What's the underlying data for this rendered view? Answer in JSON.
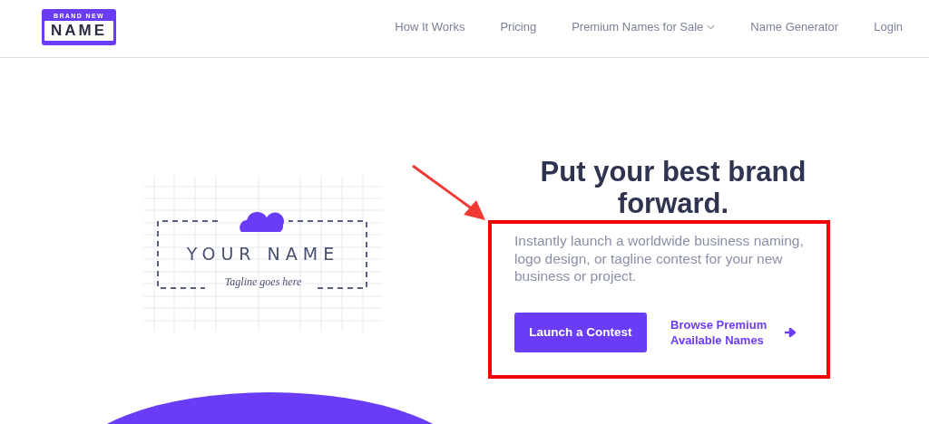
{
  "logo": {
    "top": "BRAND NEW",
    "main": "NAME"
  },
  "nav": [
    {
      "label": "How It Works",
      "dropdown": false
    },
    {
      "label": "Pricing",
      "dropdown": false
    },
    {
      "label": "Premium Names for Sale",
      "dropdown": true
    },
    {
      "label": "Name Generator",
      "dropdown": false
    },
    {
      "label": "Login",
      "dropdown": false
    }
  ],
  "illustration": {
    "name": "YOUR NAME",
    "tagline": "Tagline goes here"
  },
  "hero": {
    "title": "Put your best brand forward.",
    "description": "Instantly launch a worldwide business naming, logo design, or tagline contest for your new business or project.",
    "primary_button": "Launch a Contest",
    "link": "Browse Premium Available Names"
  }
}
